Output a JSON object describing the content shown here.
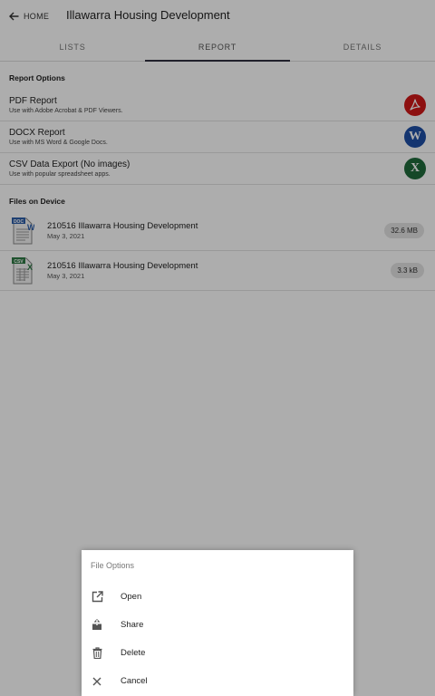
{
  "header": {
    "back_label": "HOME",
    "title": "Illawarra Housing Development"
  },
  "tabs": [
    {
      "label": "LISTS",
      "active": false
    },
    {
      "label": "REPORT",
      "active": true
    },
    {
      "label": "DETAILS",
      "active": false
    }
  ],
  "report_options": {
    "heading": "Report Options",
    "items": [
      {
        "title": "PDF Report",
        "subtitle": "Use with Adobe Acrobat & PDF Viewers.",
        "icon": "acrobat-icon",
        "color": "#d01818"
      },
      {
        "title": "DOCX Report",
        "subtitle": "Use with MS Word & Google Docs.",
        "icon": "word-icon",
        "badge": "W",
        "color": "#1e4fa6"
      },
      {
        "title": "CSV Data Export (No images)",
        "subtitle": "Use with popular spreadsheet apps.",
        "icon": "excel-icon",
        "badge": "X",
        "color": "#1f6b3c"
      }
    ]
  },
  "files": {
    "heading": "Files on Device",
    "items": [
      {
        "name": "210516 Illawarra Housing Development",
        "date": "May 3, 2021",
        "size": "32.6 MB",
        "type": "DOC",
        "mark": "W"
      },
      {
        "name": "210516 Illawarra Housing Development",
        "date": "May 3, 2021",
        "size": "3.3 kB",
        "type": "CSV",
        "mark": "X"
      }
    ]
  },
  "file_options": {
    "title": "File Options",
    "items": [
      {
        "label": "Open",
        "icon": "open-external-icon"
      },
      {
        "label": "Share",
        "icon": "share-icon"
      },
      {
        "label": "Delete",
        "icon": "trash-icon"
      },
      {
        "label": "Cancel",
        "icon": "close-icon"
      }
    ]
  }
}
